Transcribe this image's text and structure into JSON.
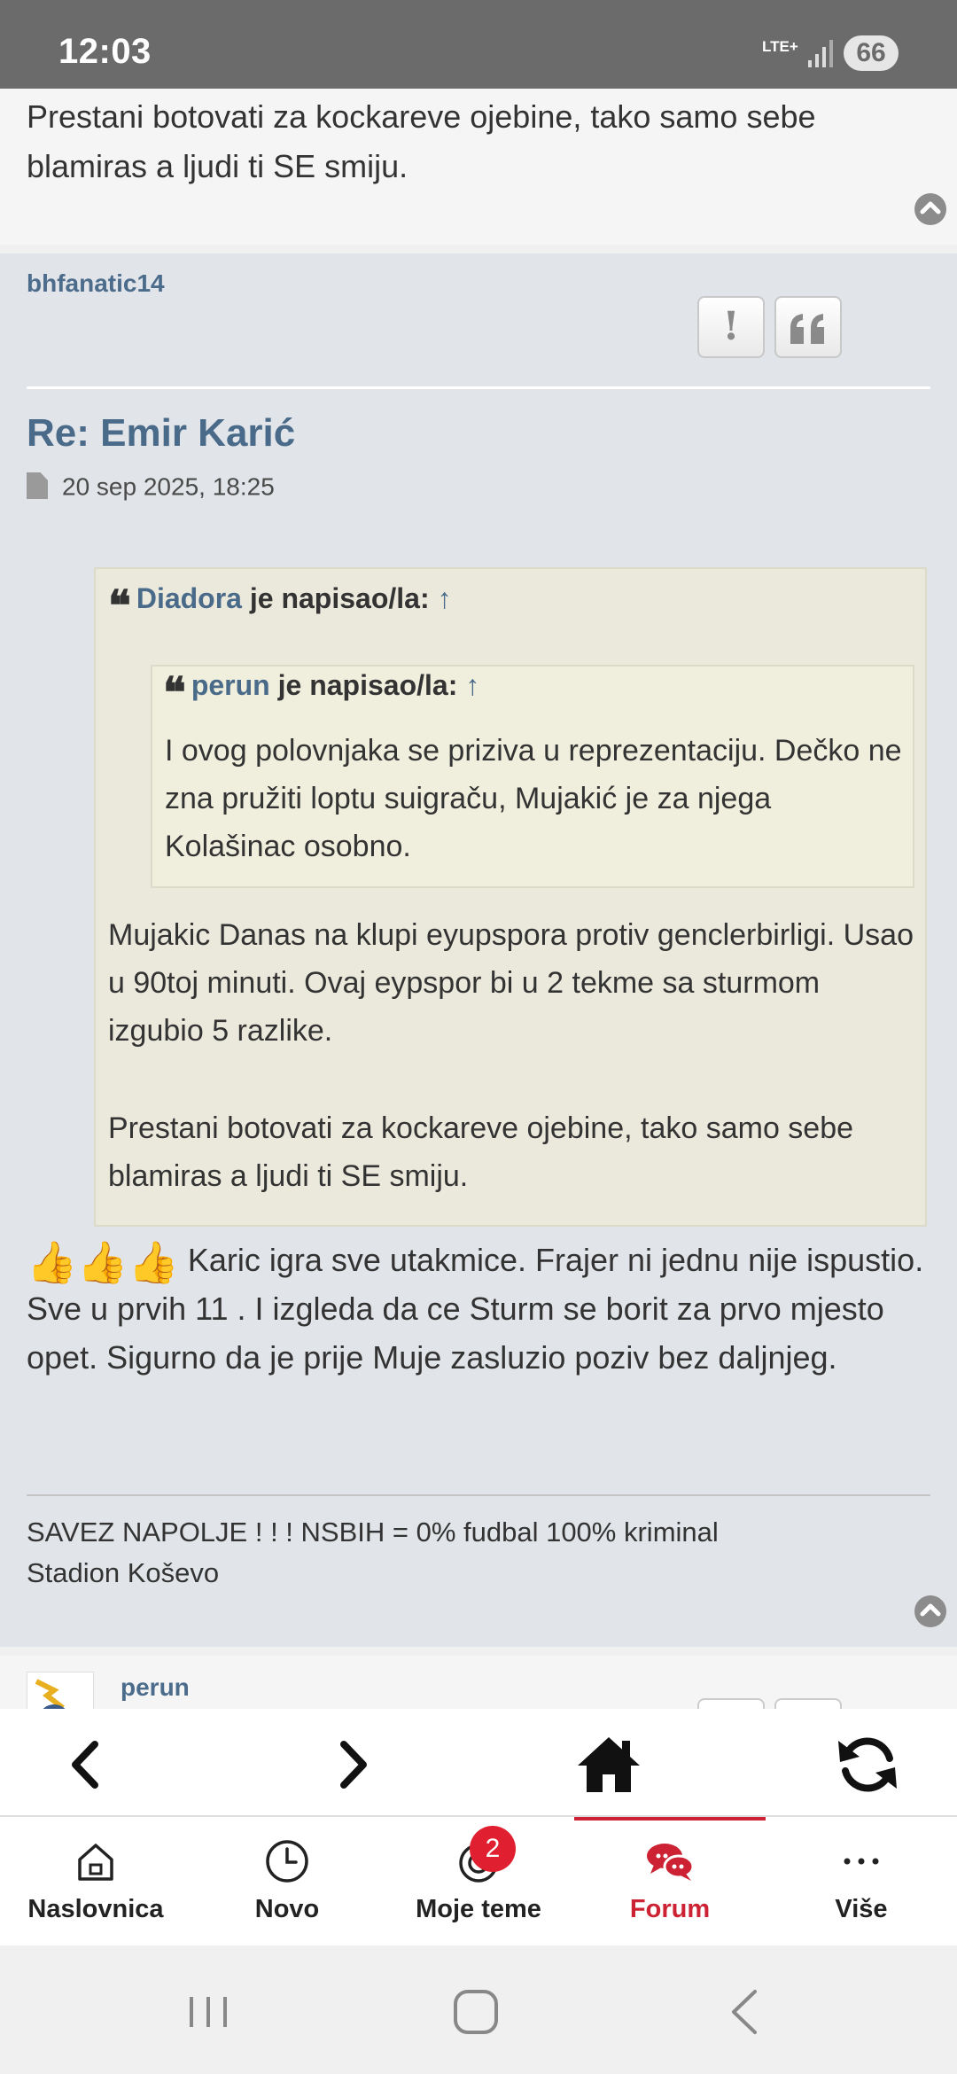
{
  "status_bar": {
    "time": "12:03",
    "network": "LTE+",
    "battery": "66"
  },
  "previous_post": {
    "text": "Prestani botovati za kockareve ojebine, tako samo sebe blamiras a ljudi ti SE smiju."
  },
  "post": {
    "author": "bhfanatic14",
    "report_icon": "!",
    "quote_icon": "quote-icon",
    "title": "Re: Emir Karić",
    "date": "20 sep 2025, 18:25",
    "quote_outer": {
      "author": "Diadora",
      "wrote": "je napisao/la:",
      "arrow": "↑",
      "inner_quote": {
        "author": "perun",
        "wrote": "je napisao/la:",
        "arrow": "↑",
        "text": "I ovog polovnjaka se priziva u reprezentaciju. Dečko ne zna pružiti loptu suigraču, Mujakić je za njega Kolašinac osobno."
      },
      "para1": "Mujakic Danas na klupi eyupspora protiv genclerbirligi. Usao u 90toj minuti. Ovaj eypspor bi u 2 tekme sa sturmom izgubio 5 razlike.",
      "para2": "Prestani botovati za kockareve ojebine, tako samo sebe blamiras a ljudi ti SE smiju."
    },
    "emojis": "👍👍👍",
    "body": "Karic igra sve utakmice. Frajer ni jednu nije ispustio. Sve u prvih 11 . I izgleda da ce Sturm se borit za prvo mjesto opet. Sigurno da je prije Muje zasluzio poziv bez daljnjeg.",
    "signature_line1": "SAVEZ NAPOLJE ! ! ! NSBIH = 0% fudbal 100% kriminal",
    "signature_line2": "Stadion Koševo"
  },
  "next_post": {
    "author": "perun"
  },
  "tabs": [
    {
      "label": "Naslovnica",
      "icon": "home-outline-icon"
    },
    {
      "label": "Novo",
      "icon": "clock-icon"
    },
    {
      "label": "Moje teme",
      "icon": "topics-icon",
      "badge": "2"
    },
    {
      "label": "Forum",
      "icon": "chat-bubbles-icon",
      "active": true
    },
    {
      "label": "Više",
      "icon": "more-dots-icon"
    }
  ],
  "colors": {
    "accent": "#cc2233",
    "link": "#4a6a8a",
    "status_bar": "#6b6b6b",
    "quote_bg": "#ebe9dc"
  }
}
